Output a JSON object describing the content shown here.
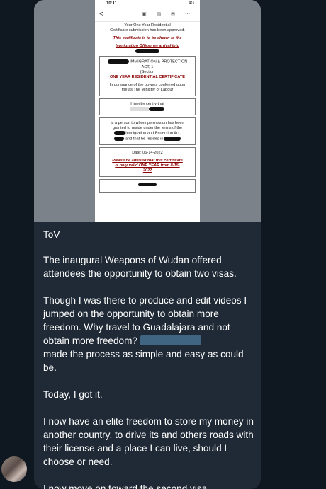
{
  "screenshot": {
    "status_time": "10:11",
    "status_network": "4G",
    "toolbar_back": "<",
    "toolbar_icons": [
      "archive-icon",
      "trash-icon",
      "mail-icon",
      "more-icon"
    ],
    "lines": {
      "approved_1": "Your One Year Residential",
      "approved_2": "Certificate submission has been approved.",
      "notice_1": "This certificate is to be shown to the",
      "notice_2": "Immigration Officer on arrival into",
      "act": "IMMIGRATION & PROTECTION",
      "act_2": "ACT, 1",
      "section": "(Section",
      "cert_title": "ONE YEAR RESIDENTIAL CERTIFICATE",
      "powers_1": "In pursuance of the powers conferred upon",
      "powers_2": "me as The Minister of Labour",
      "certify": "I hereby certify that",
      "permission_1": "is a person to whom permission has been",
      "permission_2": "granted to reside under the terms of the",
      "permission_3": "Immigration and Protection Act,",
      "permission_4": "and that he resides in",
      "date": "Date: 06-14-2022",
      "advised_1": "Please be advised that this certificate",
      "advised_2": "is only valid ONE YEAR from 8-15-",
      "advised_3": "2022"
    }
  },
  "message": {
    "author": "ToV",
    "paragraphs": [
      "The inaugural Weapons of Wudan offered attendees the opportunity to obtain two visas.",
      "Though I was there to produce and edit videos I jumped on the opportunity to obtain more freedom. Why travel to Guadalajara and not obtain more freedom?",
      "made the process as simple and easy as could be.",
      "Today, I got it.",
      "I now have an elite freedom to store my money in another country, to drive its and others roads with their license and a place I can live, should I choose or need.",
      "I now move on toward the second visa."
    ]
  },
  "colors": {
    "background": "#0f1720",
    "bubble": "#1f2a36",
    "text": "#ffffff",
    "mention": "#46708f",
    "doc_accent": "#8b0000"
  }
}
